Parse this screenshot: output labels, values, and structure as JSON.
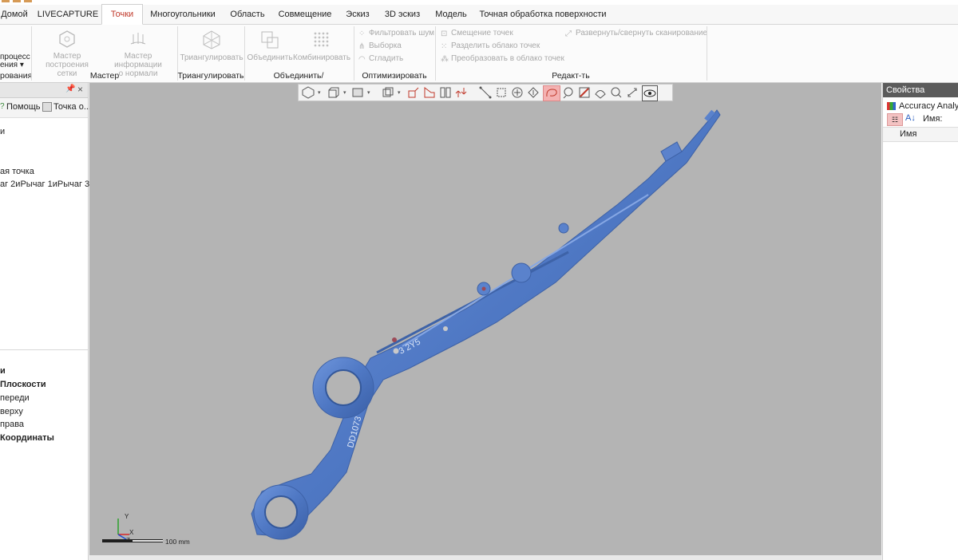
{
  "tabs": [
    "Домой",
    "LIVECAPTURE",
    "Точки",
    "Многоугольники",
    "Область",
    "Совмещение",
    "Эскиз",
    "3D эскиз",
    "Модель",
    "Точная обработка поверхности"
  ],
  "active_tab": "Точки",
  "ribbon": {
    "process_label_1": "процесс",
    "process_label_2": "ения",
    "groups": {
      "g0": "рования",
      "g1": "Мастер",
      "g2": "Триангулировать",
      "g3": "Объединить/Комбинировать",
      "g4": "Оптимизировать",
      "g5": "Редакт-ть"
    },
    "buttons": {
      "mesh_wizard_1": "Мастер",
      "mesh_wizard_2": "построения сетки",
      "normal_wizard_1": "Мастер информации",
      "normal_wizard_2": "о нормали",
      "triangulate": "Триангулировать",
      "merge": "Объединить",
      "combine": "Комбинировать",
      "filter_noise": "Фильтровать шум",
      "sampling": "Выборка",
      "smooth": "Сгладить",
      "offset_points": "Смещение точек",
      "split_cloud": "Разделить облако точек",
      "convert_cloud": "Преобразовать в облако точек",
      "expand_collapse": "Развернуть/свернуть сканирование"
    }
  },
  "left_panel": {
    "help": "Помощь",
    "point": "Точка о...",
    "tree_top": [
      "и",
      "ая точка",
      "аг 2иРычаг 1иРычаг 3"
    ],
    "tree_bottom": {
      "root": "и",
      "planes": "Плоскости",
      "front": "переди",
      "top": "верху",
      "right": "права",
      "coords": "Координаты"
    }
  },
  "right_panel": {
    "title": "Свойства",
    "item": "Accuracy Analyze",
    "name_label": "Имя:",
    "column": "Имя"
  },
  "viewport": {
    "scale_label": "100 mm",
    "part_text_1": "3 2Y5",
    "part_text_2": "DD1073",
    "axis_y": "Y",
    "axis_x": "X",
    "axis_z": "Z"
  },
  "colors": {
    "part": "#4f78c4",
    "viewport_bg": "#b4b4b4",
    "active_tab_text": "#c0392b"
  }
}
